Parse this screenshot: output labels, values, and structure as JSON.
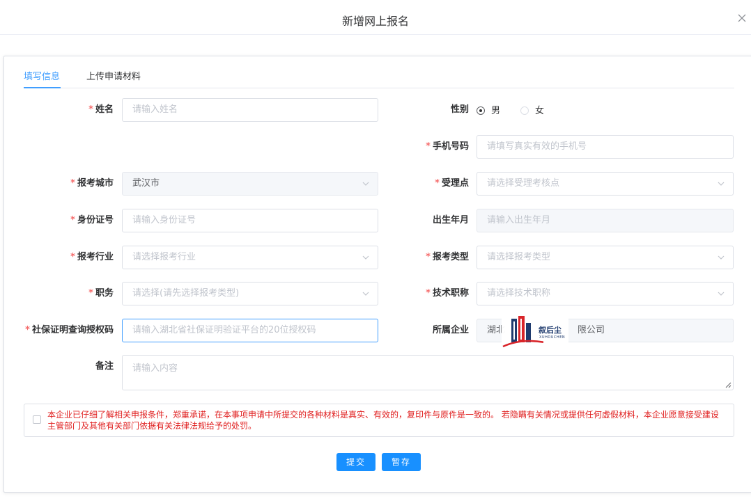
{
  "dialog": {
    "title": "新增网上报名"
  },
  "tabs": [
    {
      "label": "填写信息"
    },
    {
      "label": "上传申请材料"
    }
  ],
  "required_mark": "*",
  "form": {
    "name": {
      "label": "姓名",
      "placeholder": "请输入姓名"
    },
    "gender": {
      "label": "性别",
      "options": [
        "男",
        "女"
      ],
      "selected": "男"
    },
    "phone": {
      "label": "手机号码",
      "placeholder": "请填写真实有效的手机号"
    },
    "city": {
      "label": "报考城市",
      "value": "武汉市"
    },
    "site": {
      "label": "受理点",
      "placeholder": "请选择受理考核点"
    },
    "id_number": {
      "label": "身份证号",
      "placeholder": "请输入身份证号"
    },
    "birth": {
      "label": "出生年月",
      "placeholder": "请输入出生年月"
    },
    "industry": {
      "label": "报考行业",
      "placeholder": "请选择报考行业"
    },
    "exam_type": {
      "label": "报考类型",
      "placeholder": "请选择报考类型"
    },
    "position": {
      "label": "职务",
      "placeholder": "请选择(请先选择报考类型)"
    },
    "title": {
      "label": "技术职称",
      "placeholder": "请选择技术职称"
    },
    "social_code": {
      "label": "社保证明查询授权码",
      "placeholder": "请输入湖北省社保证明验证平台的20位授权码"
    },
    "company": {
      "label": "所属企业",
      "value_prefix": "湖北",
      "value_suffix": "限公司"
    },
    "remark": {
      "label": "备注",
      "placeholder": "请输入内容"
    }
  },
  "declaration": {
    "text": "本企业已仔细了解相关申报条件，郑重承诺，在本事项申请中所提交的各种材料是真实、有效的，复印件与原件是一致的。 若隐瞒有关情况或提供任何虚假材料，本企业愿意接受建设主管部门及其他有关部门依据有关法律法规给予的处罚。"
  },
  "buttons": {
    "submit": "提交",
    "save": "暂存"
  },
  "watermark": {
    "name": "叙后尘",
    "sub": "XUHOUCHEN"
  },
  "colors": {
    "primary": "#409eff",
    "button": "#1890ff",
    "required": "#f56c6c",
    "declaration": "#e02020",
    "logo_red": "#d9252a",
    "logo_navy": "#1f3b6e"
  }
}
